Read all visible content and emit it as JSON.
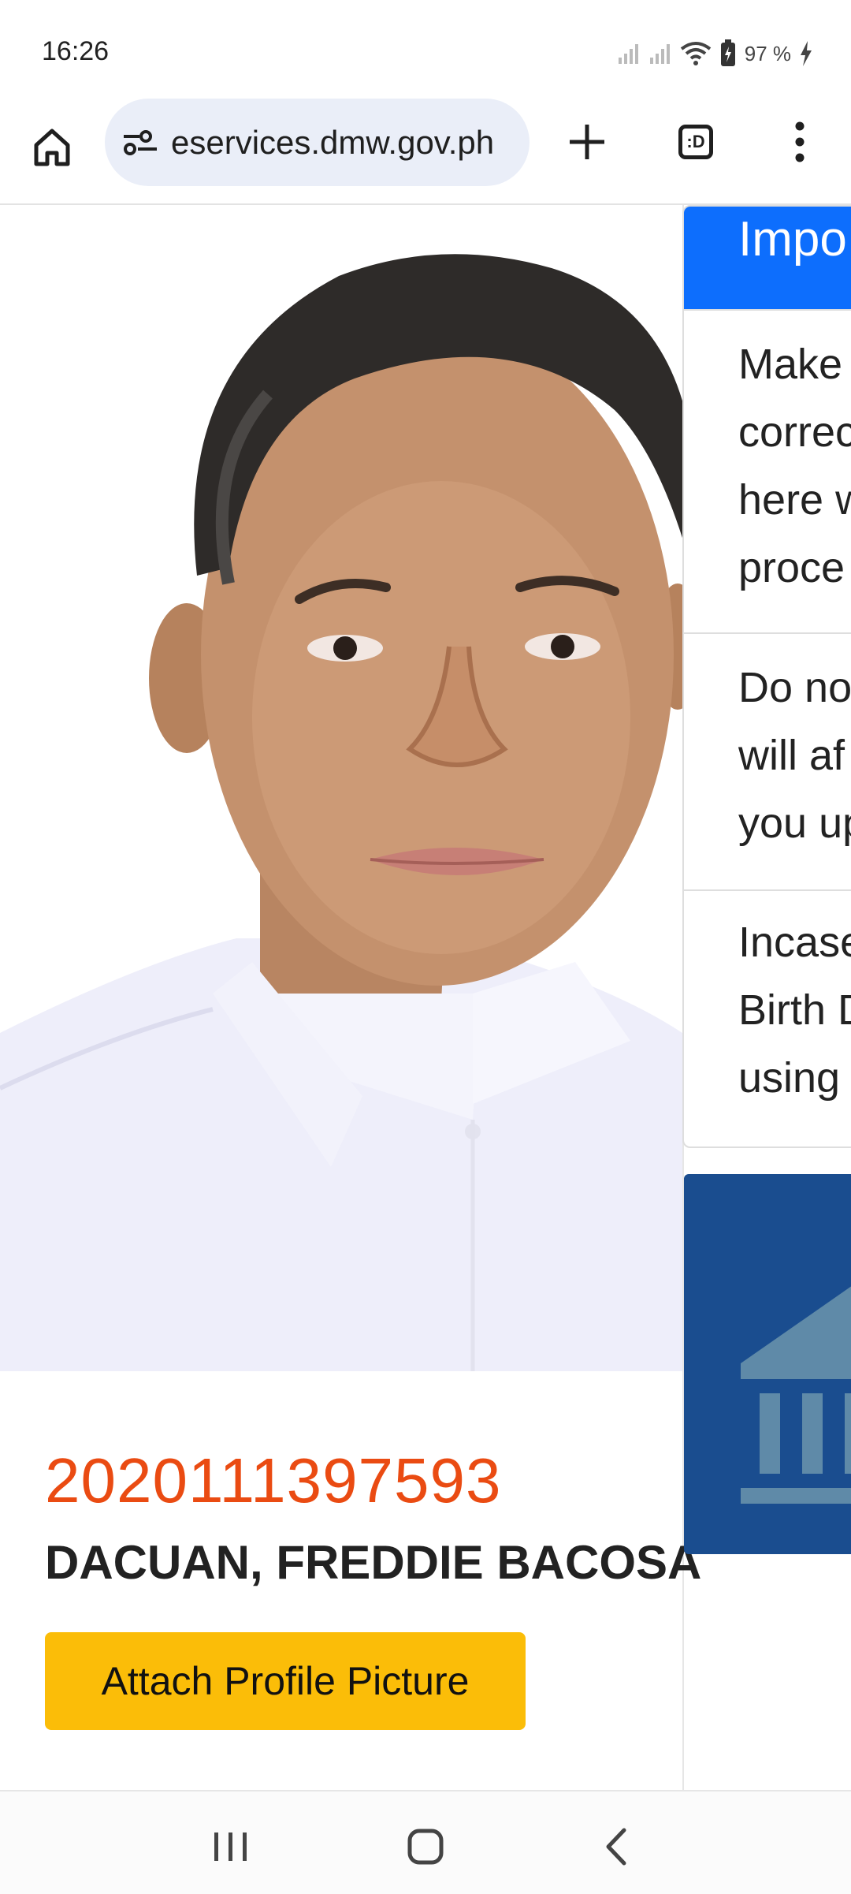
{
  "status_bar": {
    "time": "16:26",
    "battery": "97 %"
  },
  "browser": {
    "url": "eservices.dmw.gov.ph",
    "tab_count_label": ":D"
  },
  "profile": {
    "account_id": "2020111397593",
    "name": "DACUAN, FREDDIE BACOSA",
    "attach_button": "Attach Profile Picture"
  },
  "important": {
    "title": "Impo",
    "notes": [
      "Make\ncorrec\nhere w\nproce",
      "Do no\nwill af\nyou up",
      "Incase\nBirth D\nusing"
    ]
  },
  "colors": {
    "accent_primary": "#0d6efd",
    "id_orange": "#ea4b12",
    "button_yellow": "#fbbd08",
    "bank_card_blue": "#1a4d8f"
  },
  "icons": [
    "home-icon",
    "site-settings-icon",
    "plus-icon",
    "tabs-icon",
    "more-vert-icon",
    "bank-icon",
    "recents-icon",
    "home-nav-icon",
    "back-icon"
  ]
}
